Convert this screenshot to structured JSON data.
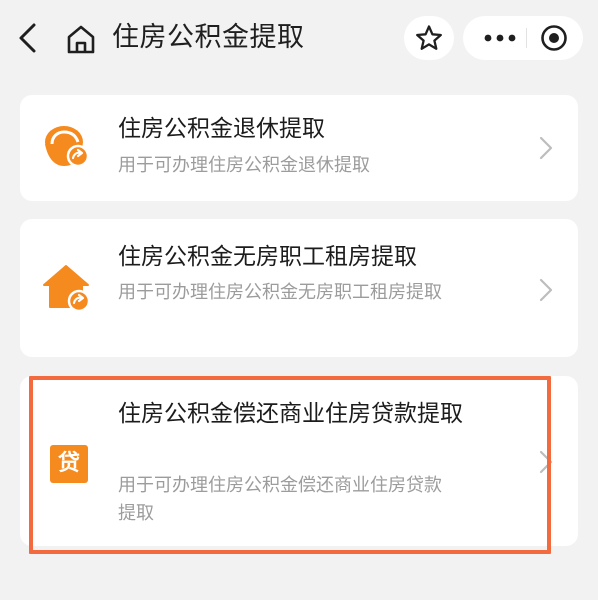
{
  "header": {
    "title": "住房公积金提取",
    "back_icon": "back-arrow-icon",
    "home_icon": "home-icon",
    "favorite_icon": "star-icon",
    "more_icon": "more-dots-icon",
    "close_icon": "target-circle-icon"
  },
  "items": [
    {
      "title": "住房公积金退休提取",
      "subtitle": "用于可办理住房公积金退休提取",
      "icon": "retire-person-icon"
    },
    {
      "title": "住房公积金无房职工租房提取",
      "subtitle": "用于可办理住房公积金无房职工租房提取",
      "icon": "house-rent-icon"
    },
    {
      "title": "住房公积金偿还商业住房贷款提取",
      "subtitle": "用于可办理住房公积金偿还商业住房贷款提取",
      "icon": "loan-icon",
      "icon_text": "贷",
      "highlighted": true
    }
  ],
  "colors": {
    "accent_orange": "#f58a1f",
    "highlight_border": "#f26a3e",
    "background": "#f2f2f2",
    "card": "#ffffff",
    "subtitle_gray": "#9c9c9c"
  }
}
